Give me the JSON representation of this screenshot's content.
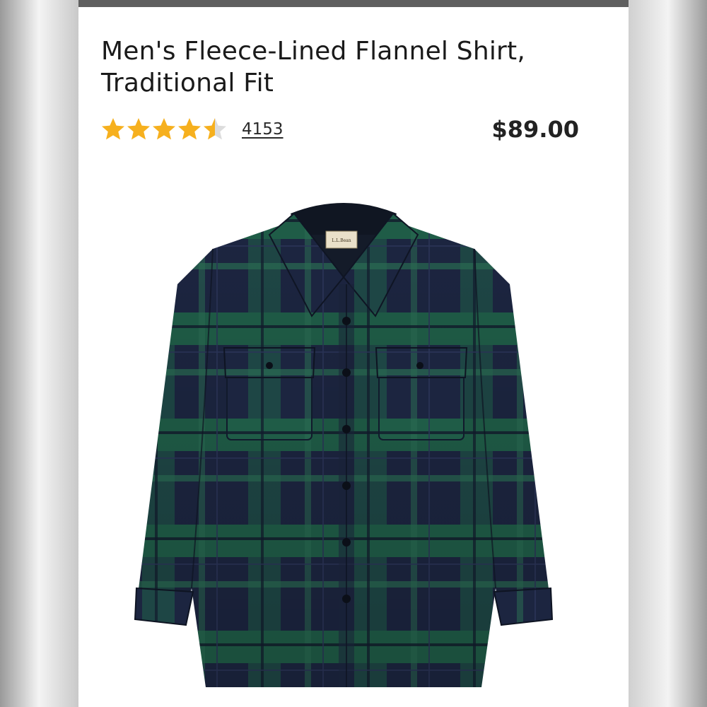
{
  "product": {
    "title": "Men's Fleece-Lined Flannel Shirt, Traditional Fit",
    "rating": 4.5,
    "rating_max": 5,
    "review_count": "4153",
    "price": "$89.00",
    "label_brand": "L.L.Bean"
  },
  "colors": {
    "star": "#f6b01e",
    "plaid_navy": "#1c2540",
    "plaid_green": "#1f5c47"
  },
  "icons": [
    "star-icon",
    "half-star-icon"
  ]
}
